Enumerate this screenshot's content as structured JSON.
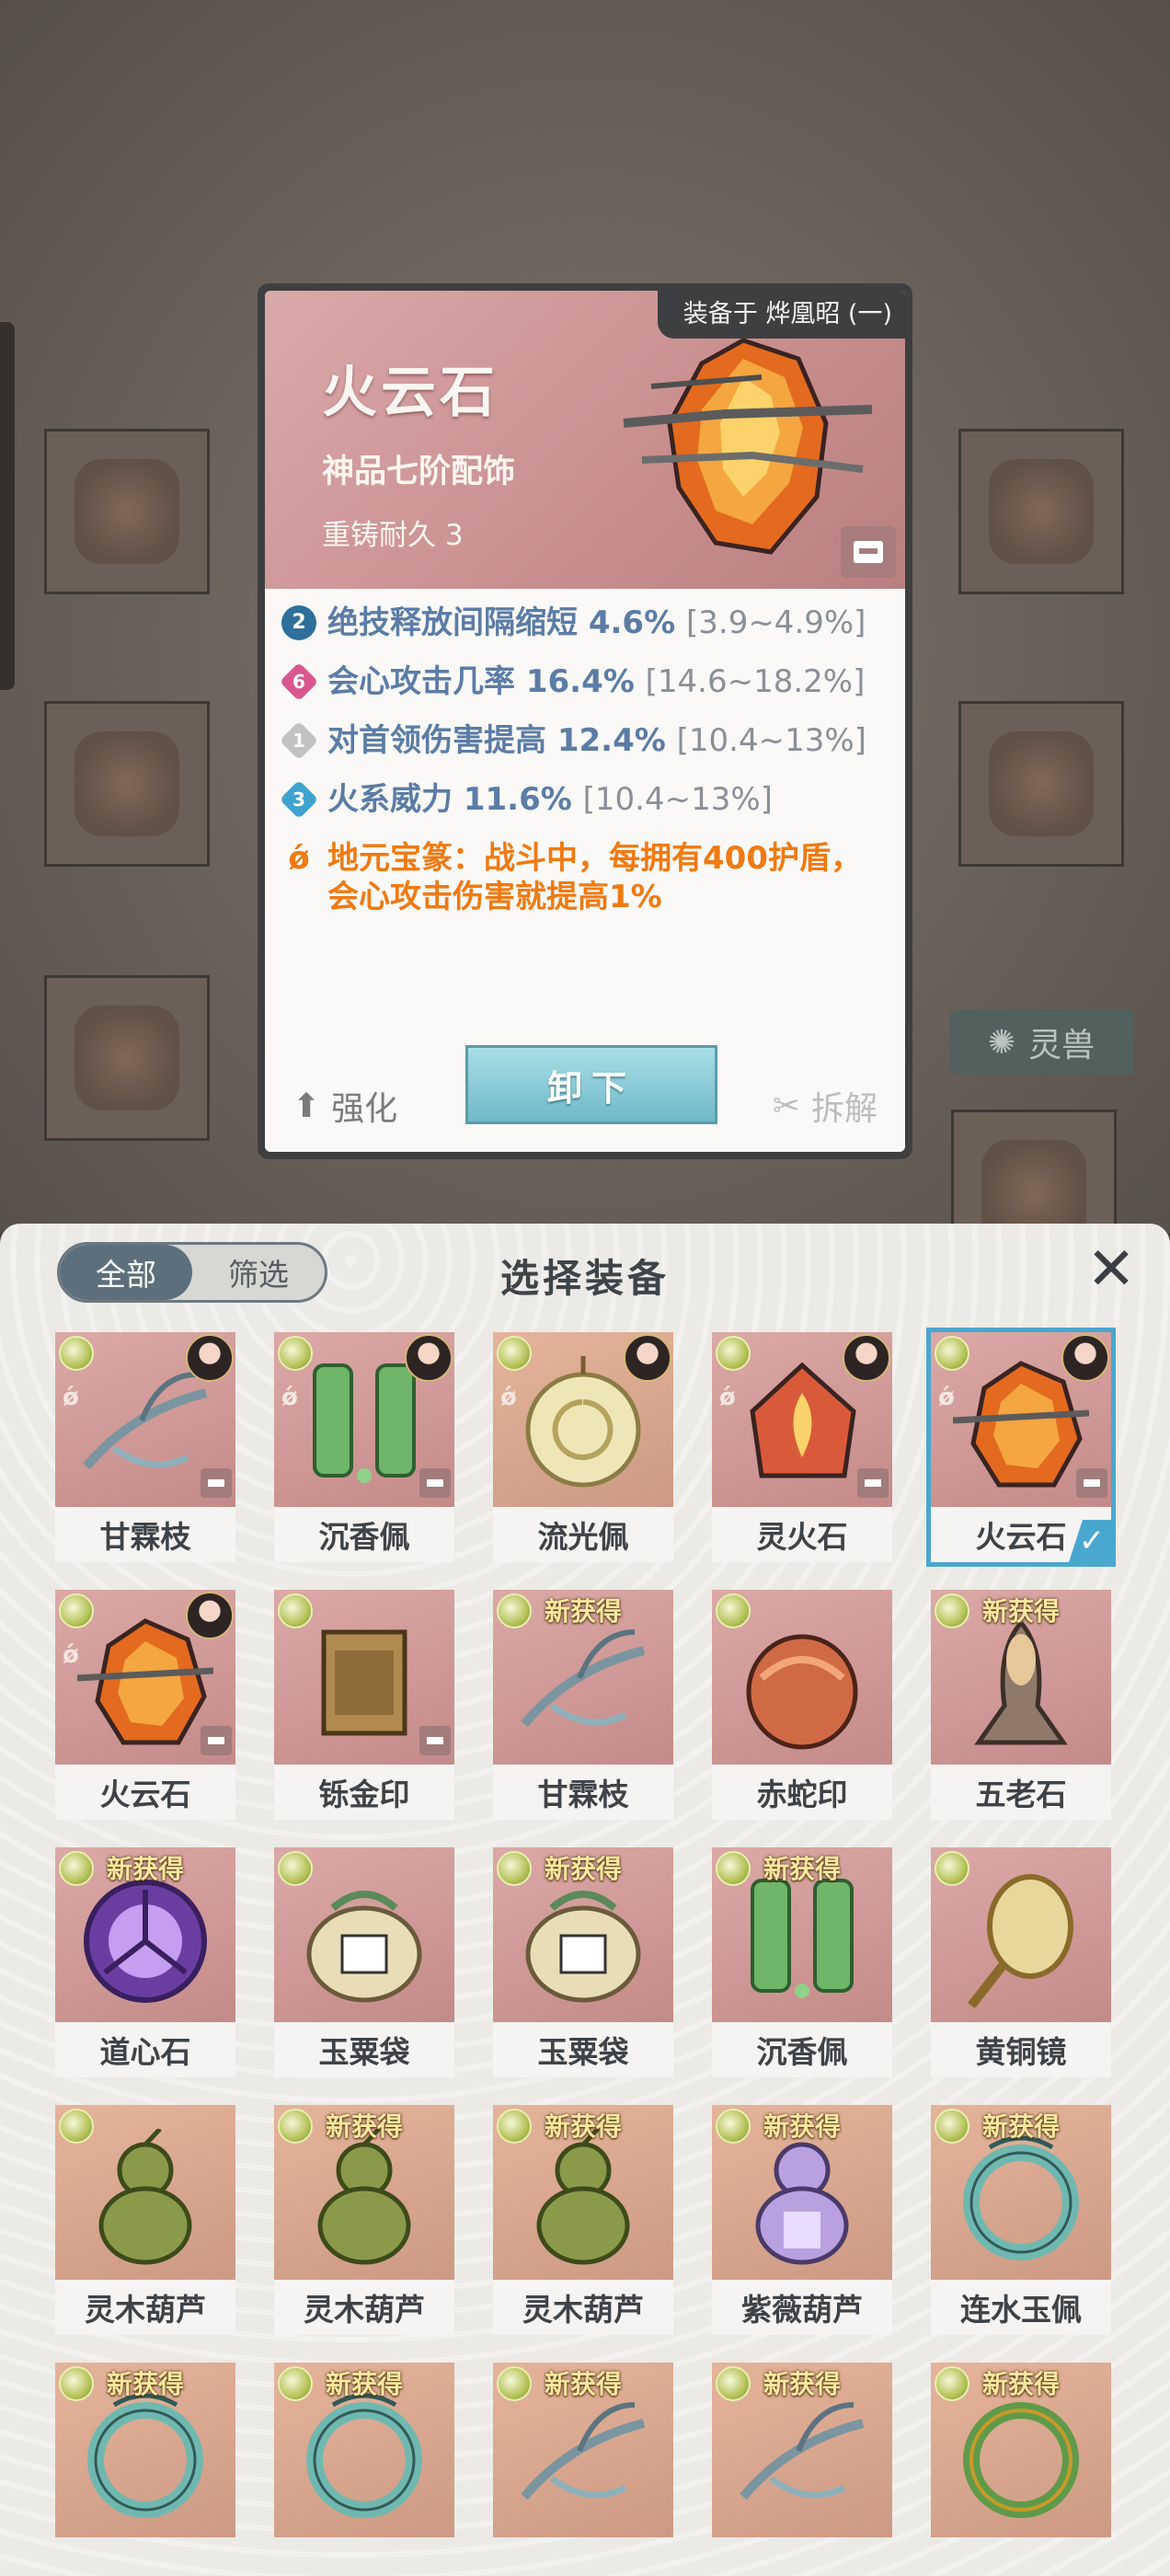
{
  "background": {
    "side_tab": {
      "icon": "spirit-beast-icon",
      "label": "灵兽"
    }
  },
  "detail_card": {
    "equipped_label": "装备于 烨凰昭 (一)",
    "name": "火云石",
    "grade": "神品七阶配饰",
    "recast": "重铸耐久 3",
    "attributes": [
      {
        "icon": "skill-cooldown-icon",
        "badge": "2",
        "text": "绝技释放间隔缩短 4.6%",
        "range": "[3.9~4.9%]",
        "color": "#5b7ca6"
      },
      {
        "icon": "pink-diamond-icon",
        "badge": "6",
        "text": "会心攻击几率 16.4%",
        "range": "[14.6~18.2%]",
        "color": "#5b7ca6"
      },
      {
        "icon": "grey-diamond-icon",
        "badge": "1",
        "text": "对首领伤害提高 12.4%",
        "range": "[10.4~13%]",
        "color": "#5b7ca6"
      },
      {
        "icon": "cyan-diamond-icon",
        "badge": "3",
        "text": "火系威力 11.6%",
        "range": "[10.4~13%]",
        "color": "#5b7ca6"
      }
    ],
    "special": {
      "icon": "rune-icon",
      "text": "地元宝篆：战斗中，每拥有400护盾，会心攻击伤害就提高1%",
      "color": "#f07a12"
    },
    "unequip_label": "卸下",
    "enhance_label": "强化",
    "dismantle_label": "拆解"
  },
  "panel": {
    "title": "选择装备",
    "filters": {
      "all": "全部",
      "filter": "筛选"
    },
    "close": "X",
    "items": [
      {
        "name": "甘霖枝",
        "new": false,
        "rune": true,
        "lock": true,
        "portrait": true,
        "tone": "pink",
        "art": "branch"
      },
      {
        "name": "沉香佩",
        "new": false,
        "rune": true,
        "lock": true,
        "portrait": true,
        "tone": "pink",
        "art": "jade"
      },
      {
        "name": "流光佩",
        "new": false,
        "rune": true,
        "lock": false,
        "portrait": true,
        "tone": "tan",
        "art": "disc"
      },
      {
        "name": "灵火石",
        "new": false,
        "rune": true,
        "lock": true,
        "portrait": true,
        "tone": "pink",
        "art": "fire"
      },
      {
        "name": "火云石",
        "new": false,
        "rune": true,
        "lock": true,
        "portrait": true,
        "tone": "pink",
        "art": "rock",
        "selected": true
      },
      {
        "name": "火云石",
        "new": false,
        "rune": true,
        "lock": true,
        "portrait": true,
        "tone": "pink",
        "art": "rock"
      },
      {
        "name": "铄金印",
        "new": false,
        "rune": false,
        "lock": true,
        "portrait": false,
        "tone": "pink",
        "art": "seal"
      },
      {
        "name": "甘霖枝",
        "new": true,
        "rune": false,
        "lock": false,
        "portrait": false,
        "tone": "pink",
        "art": "branch"
      },
      {
        "name": "赤蛇印",
        "new": false,
        "rune": false,
        "lock": false,
        "portrait": false,
        "tone": "pink",
        "art": "snake"
      },
      {
        "name": "五老石",
        "new": true,
        "rune": false,
        "lock": false,
        "portrait": false,
        "tone": "pink",
        "art": "stone"
      },
      {
        "name": "道心石",
        "new": true,
        "rune": false,
        "lock": false,
        "portrait": false,
        "tone": "pink",
        "art": "orb"
      },
      {
        "name": "玉粟袋",
        "new": false,
        "rune": false,
        "lock": false,
        "portrait": false,
        "tone": "pink",
        "art": "bag"
      },
      {
        "name": "玉粟袋",
        "new": true,
        "rune": false,
        "lock": false,
        "portrait": false,
        "tone": "pink",
        "art": "bag"
      },
      {
        "name": "沉香佩",
        "new": true,
        "rune": false,
        "lock": false,
        "portrait": false,
        "tone": "pink",
        "art": "jade"
      },
      {
        "name": "黄铜镜",
        "new": false,
        "rune": false,
        "lock": false,
        "portrait": false,
        "tone": "pink",
        "art": "mirror"
      },
      {
        "name": "灵木葫芦",
        "new": false,
        "rune": false,
        "lock": false,
        "portrait": false,
        "tone": "tan",
        "art": "gourd"
      },
      {
        "name": "灵木葫芦",
        "new": true,
        "rune": false,
        "lock": false,
        "portrait": false,
        "tone": "tan",
        "art": "gourd"
      },
      {
        "name": "灵木葫芦",
        "new": true,
        "rune": false,
        "lock": false,
        "portrait": false,
        "tone": "tan",
        "art": "gourd"
      },
      {
        "name": "紫薇葫芦",
        "new": true,
        "rune": false,
        "lock": false,
        "portrait": false,
        "tone": "tan",
        "art": "purple-gourd"
      },
      {
        "name": "连水玉佩",
        "new": true,
        "rune": false,
        "lock": false,
        "portrait": false,
        "tone": "tan",
        "art": "ring"
      },
      {
        "name": "",
        "new": true,
        "rune": false,
        "lock": false,
        "portrait": false,
        "tone": "tan",
        "art": "ring"
      },
      {
        "name": "",
        "new": true,
        "rune": false,
        "lock": false,
        "portrait": false,
        "tone": "tan",
        "art": "ring"
      },
      {
        "name": "",
        "new": true,
        "rune": false,
        "lock": false,
        "portrait": false,
        "tone": "tan",
        "art": "branch"
      },
      {
        "name": "",
        "new": true,
        "rune": false,
        "lock": false,
        "portrait": false,
        "tone": "tan",
        "art": "branch"
      },
      {
        "name": "",
        "new": true,
        "rune": false,
        "lock": false,
        "portrait": false,
        "tone": "tan",
        "art": "green-ring"
      }
    ],
    "new_label": "新获得"
  }
}
